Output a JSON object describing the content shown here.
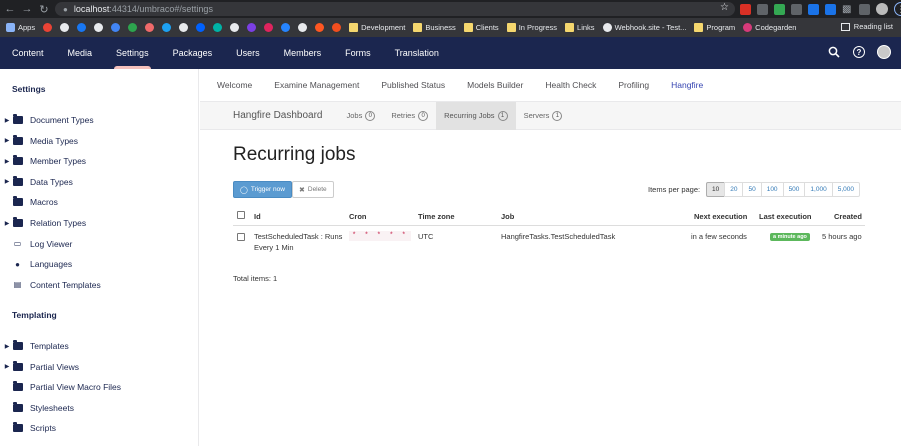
{
  "browser": {
    "url_host": "localhost",
    "url_port_path": ":44314/umbraco#/settings",
    "bookmarks": [
      {
        "label": "Apps",
        "icon": "apps-grid-icon"
      },
      {
        "label": "Development",
        "icon": "folder-icon"
      },
      {
        "label": "Business",
        "icon": "folder-icon"
      },
      {
        "label": "Clients",
        "icon": "folder-icon"
      },
      {
        "label": "In Progress",
        "icon": "folder-icon"
      },
      {
        "label": "Links",
        "icon": "folder-icon"
      },
      {
        "label": "Webhook.site - Test...",
        "icon": "webhook-icon"
      },
      {
        "label": "Program",
        "icon": "folder-icon"
      },
      {
        "label": "Codegarden",
        "icon": "codegarden-icon"
      }
    ],
    "reading_list": "Reading list",
    "favicon_colors": [
      "#ea4335",
      "#e8eaed",
      "#1877f2",
      "#e8eaed",
      "#4285f4",
      "#2da44e",
      "#f06a6a",
      "#1da1f2",
      "#e8eaed",
      "#0061fe",
      "#00b3a6",
      "#e8eaed",
      "#7b3fe4",
      "#e0245e",
      "#2684ff",
      "#e8eaed",
      "#ff5722",
      "#f24e1e"
    ]
  },
  "header": {
    "tabs": [
      "Content",
      "Media",
      "Settings",
      "Packages",
      "Users",
      "Members",
      "Forms",
      "Translation"
    ],
    "active_tab": "Settings",
    "active_indicator_color": "#f5c1bc",
    "background_color": "#1b264f"
  },
  "sidebar": {
    "settings_title": "Settings",
    "settings_items": [
      {
        "label": "Document Types",
        "expandable": true,
        "icon": "folder-icon"
      },
      {
        "label": "Media Types",
        "expandable": true,
        "icon": "folder-icon"
      },
      {
        "label": "Member Types",
        "expandable": true,
        "icon": "folder-icon"
      },
      {
        "label": "Data Types",
        "expandable": true,
        "icon": "folder-icon"
      },
      {
        "label": "Macros",
        "expandable": false,
        "icon": "folder-icon"
      },
      {
        "label": "Relation Types",
        "expandable": true,
        "icon": "folder-icon"
      },
      {
        "label": "Log Viewer",
        "expandable": false,
        "icon": "monitor-icon"
      },
      {
        "label": "Languages",
        "expandable": false,
        "icon": "globe-icon"
      },
      {
        "label": "Content Templates",
        "expandable": false,
        "icon": "document-icon"
      }
    ],
    "templating_title": "Templating",
    "templating_items": [
      {
        "label": "Templates",
        "expandable": true,
        "icon": "folder-icon"
      },
      {
        "label": "Partial Views",
        "expandable": true,
        "icon": "folder-icon"
      },
      {
        "label": "Partial View Macro Files",
        "expandable": false,
        "icon": "folder-icon"
      },
      {
        "label": "Stylesheets",
        "expandable": false,
        "icon": "folder-icon"
      },
      {
        "label": "Scripts",
        "expandable": false,
        "icon": "folder-icon"
      }
    ]
  },
  "subnav": {
    "tabs": [
      "Welcome",
      "Examine Management",
      "Published Status",
      "Models Builder",
      "Health Check",
      "Profiling",
      "Hangfire"
    ],
    "active_tab": "Hangfire"
  },
  "hangfire": {
    "brand": "Hangfire Dashboard",
    "links": [
      {
        "label": "Jobs",
        "count": "0"
      },
      {
        "label": "Retries",
        "count": "0"
      },
      {
        "label": "Recurring Jobs",
        "count": "1"
      },
      {
        "label": "Servers",
        "count": "1"
      }
    ],
    "active_link": "Recurring Jobs",
    "page_title": "Recurring jobs",
    "trigger_button": "Trigger now",
    "delete_button": "Delete",
    "items_per_page_label": "Items per page:",
    "page_sizes": [
      "10",
      "20",
      "50",
      "100",
      "500",
      "1,000",
      "5,000"
    ],
    "selected_page_size": "10",
    "table": {
      "columns": [
        "Id",
        "Cron",
        "Time zone",
        "Job",
        "Next execution",
        "Last execution",
        "Created"
      ],
      "rows": [
        {
          "id": "TestScheduledTask : Runs Every 1 Min",
          "cron": "* * * * *",
          "time_zone": "UTC",
          "job": "HangfireTasks.TestScheduledTask",
          "next_execution": "in a few seconds",
          "last_execution": "a minute ago",
          "created": "5 hours ago"
        }
      ]
    },
    "total_items": "Total items: 1"
  }
}
